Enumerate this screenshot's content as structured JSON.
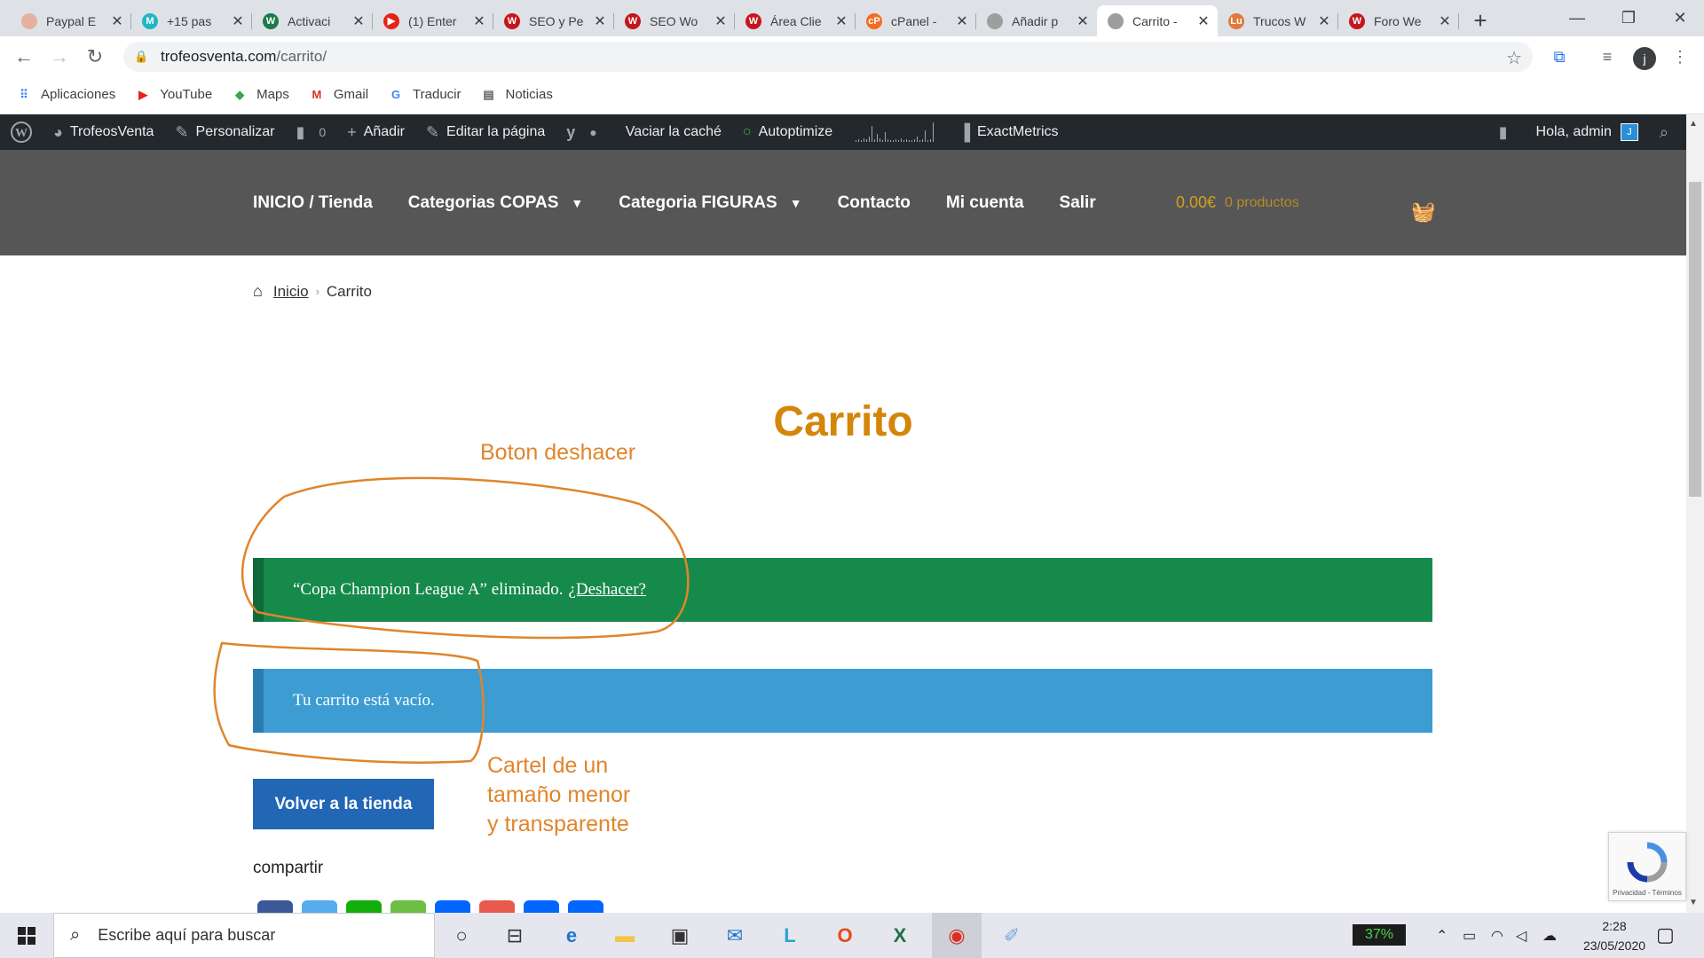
{
  "browser": {
    "tabs": [
      {
        "title": "Paypal E",
        "fav_color": "#e6b0a0",
        "fav": ""
      },
      {
        "title": "+15 pas",
        "fav_color": "#1fb8c2",
        "fav": "M"
      },
      {
        "title": "Activaci",
        "fav_color": "#1c7b4a",
        "fav": "W"
      },
      {
        "title": "(1) Enter",
        "fav_color": "#e62117",
        "fav": "▶"
      },
      {
        "title": "SEO y Pe",
        "fav_color": "#c4161c",
        "fav": "W"
      },
      {
        "title": "SEO Wo",
        "fav_color": "#c4161c",
        "fav": "W"
      },
      {
        "title": "Área Clie",
        "fav_color": "#c4161c",
        "fav": "W"
      },
      {
        "title": "cPanel -",
        "fav_color": "#f26d21",
        "fav": "cP"
      },
      {
        "title": "Añadir p",
        "fav_color": "#9e9e9e",
        "fav": ""
      },
      {
        "title": "Carrito -",
        "fav_color": "#9e9e9e",
        "fav": ""
      },
      {
        "title": "Trucos W",
        "fav_color": "#e07a3c",
        "fav": "Lu"
      },
      {
        "title": "Foro We",
        "fav_color": "#c4161c",
        "fav": "W"
      }
    ],
    "active_tab": 9,
    "close_glyph": "✕",
    "new_tab_glyph": "+",
    "window_controls": [
      "—",
      "❐",
      "✕"
    ],
    "url_domain": "trofeosventa.com",
    "url_path": "/carrito/",
    "profile_initial": "j",
    "bookmarks": [
      {
        "label": "Aplicaciones",
        "icon": "apps-grid-icon",
        "color": "#4285f4"
      },
      {
        "label": "YouTube",
        "icon": "youtube-icon",
        "color": "#e62117"
      },
      {
        "label": "Maps",
        "icon": "maps-icon",
        "color": "#34a853"
      },
      {
        "label": "Gmail",
        "icon": "gmail-icon",
        "color": "#d93025"
      },
      {
        "label": "Traducir",
        "icon": "translate-icon",
        "color": "#4285f4"
      },
      {
        "label": "Noticias",
        "icon": "news-icon",
        "color": "#5f6368"
      }
    ]
  },
  "adminbar": {
    "site_name": "TrofeosVenta",
    "customize": "Personalizar",
    "comments_count": "0",
    "new": "Añadir",
    "edit_page": "Editar la página",
    "clear_cache": "Vaciar la caché",
    "autoptimize": "Autoptimize",
    "exactmetrics": "ExactMetrics",
    "greeting": "Hola, admin",
    "avatar_initial": "J",
    "sparkline": [
      2,
      3,
      2,
      4,
      3,
      5,
      16,
      3,
      8,
      4,
      2,
      10,
      3,
      2,
      2,
      3,
      2,
      4,
      2,
      3,
      2,
      2,
      3,
      5,
      2,
      3,
      12,
      2,
      3,
      20
    ]
  },
  "sitenav": {
    "items": [
      {
        "label": "INICIO / Tienda",
        "dropdown": false
      },
      {
        "label": "Categorias COPAS",
        "dropdown": true
      },
      {
        "label": "Categoria FIGURAS",
        "dropdown": true
      },
      {
        "label": "Contacto",
        "dropdown": false
      },
      {
        "label": "Mi cuenta",
        "dropdown": false
      },
      {
        "label": "Salir",
        "dropdown": false
      }
    ],
    "cart_amount": "0.00€",
    "cart_items": "0 productos"
  },
  "page": {
    "breadcrumb_home": "Inicio",
    "breadcrumb_current": "Carrito",
    "title": "Carrito",
    "removed_notice": "“Copa Champion League A” eliminado.",
    "undo_link": "¿Deshacer?",
    "empty_notice": "Tu carrito está vacío.",
    "return_button": "Volver a la tienda",
    "share_label": "compartir",
    "share_buttons": [
      {
        "name": "facebook",
        "color": "#3b5998"
      },
      {
        "name": "twitter",
        "color": "#55acee"
      },
      {
        "name": "whatsapp",
        "color": "#12af0a"
      },
      {
        "name": "sms",
        "color": "#6cbe45"
      },
      {
        "name": "email",
        "color": "#0166ff"
      },
      {
        "name": "gmail",
        "color": "#e75a4d"
      },
      {
        "name": "print",
        "color": "#0166ff"
      },
      {
        "name": "share",
        "color": "#0166ff"
      }
    ],
    "recaptcha_text": "Privacidad - Términos"
  },
  "annotations": {
    "undo_label": "Boton deshacer",
    "note_line1": "Cartel de un",
    "note_line2": "tamaño menor",
    "note_line3": "y transparente",
    "color": "#e0852c"
  },
  "taskbar": {
    "search_placeholder": "Escribe aquí para buscar",
    "battery": "37%",
    "time": "2:28",
    "date": "23/05/2020"
  }
}
